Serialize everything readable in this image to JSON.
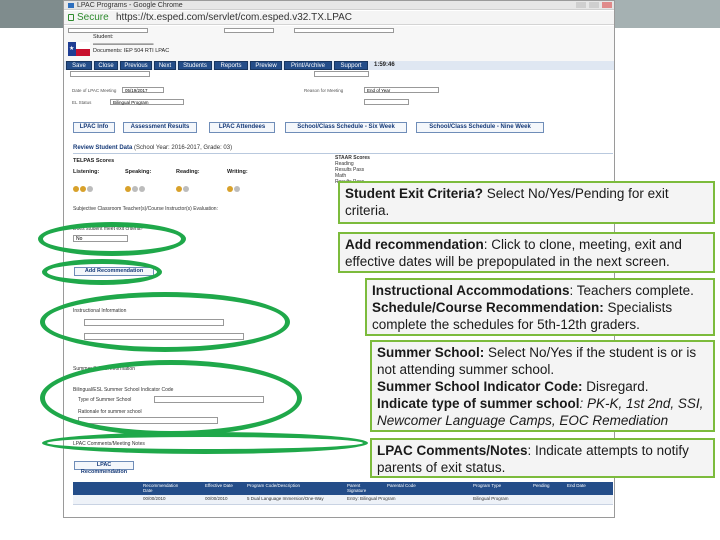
{
  "browser": {
    "window_title": "LPAC Programs - Google Chrome",
    "secure_label": "Secure",
    "url": "https://tx.esped.com/servlet/com.esped.v32.TX.LPAC"
  },
  "header": {
    "student_label": "Student:",
    "documents_label": "Documents:",
    "forms_label": "Forms:",
    "doc_items": [
      "IEP",
      "504",
      "RTI",
      "LPAC"
    ]
  },
  "nav": {
    "tabs": [
      "Save",
      "Close",
      "Previous",
      "Next",
      "Students",
      "Reports",
      "Preview",
      "Print/Archive",
      "Support"
    ],
    "timer": "1:59:46"
  },
  "form_top": {
    "date_label": "Date of LPAC Meeting",
    "date_value": "05/19/2017",
    "reason_label": "Reason for Meeting",
    "reason_value": "End of Year",
    "program_value": "Bilingual Program",
    "el_status_label": "EL Status"
  },
  "buttons": [
    "LPAC Info",
    "Assessment Results",
    "LPAC Attendees",
    "School/Class Schedule - Six Week",
    "School/Class Schedule - Nine Week"
  ],
  "review": {
    "title": "Review Student Data",
    "year": "(School Year: 2016-2017, Grade: 03)",
    "telpas_label": "TELPAS Scores",
    "skills": [
      "Listening:",
      "Speaking:",
      "Reading:",
      "Writing:"
    ],
    "staar_label": "STAAR Scores",
    "staar_lines": [
      "Reading",
      "Results Pass",
      "Math",
      "Results Pass"
    ]
  },
  "lower_form": {
    "eval_label": "Subjective Classroom Teacher(s)/Course Instructor(s) Evaluation:",
    "exit_question": "Does student meet exit criteria?",
    "exit_value": "No",
    "add_rec": "Add Recommendation",
    "instruct_label": "Instructional Information",
    "summer_label": "Summer School Information",
    "summer_indicator": "Bilingual/ESL Summer School Indicator Code",
    "summer_type": "Type of Summer School",
    "rationale": "Rationale for summer school",
    "comments_label": "LPAC Comments/Meeting Notes",
    "lpac_rec": "LPAC Recommendation"
  },
  "table": {
    "headers": [
      "Recommendation Date",
      "Effective Date",
      "Program Code/Description",
      "Parent Signature",
      "Parental Code",
      "Program Type",
      "Pending",
      "End Date"
    ],
    "row": [
      "00/00/2010",
      "00/00/2010",
      "5 Dual Language Immersion/One-Way",
      "Entry: Bilingual Program",
      "",
      "Bilingual Program",
      "",
      ""
    ]
  },
  "callouts": [
    {
      "bold": "Student Exit Criteria?",
      "text": " Select No/Yes/Pending for exit criteria."
    },
    {
      "bold": "Add recommendation",
      "text": ": Click to clone, meeting, exit and effective dates will be prepopulated in the next screen."
    },
    {
      "bold1": "Instructional Accommodations",
      "text1": ": Teachers complete.",
      "bold2": "Schedule/Course Recommendation:",
      "text2": " Specialists complete the schedules for 5th-12th graders."
    },
    {
      "bold1": "Summer School:",
      "text1": " Select No/Yes if the student is or is not attending summer school.",
      "bold2": "Summer School Indicator Code:",
      "text2": " Disregard.",
      "bold3": "Indicate type of summer school",
      "text3": ": PK-K, 1st 2nd, SSI, Newcomer Language Camps, EOC Remediation"
    },
    {
      "bold": "LPAC Comments/Notes",
      "text": ": Indicate attempts to notify parents of exit status."
    }
  ]
}
